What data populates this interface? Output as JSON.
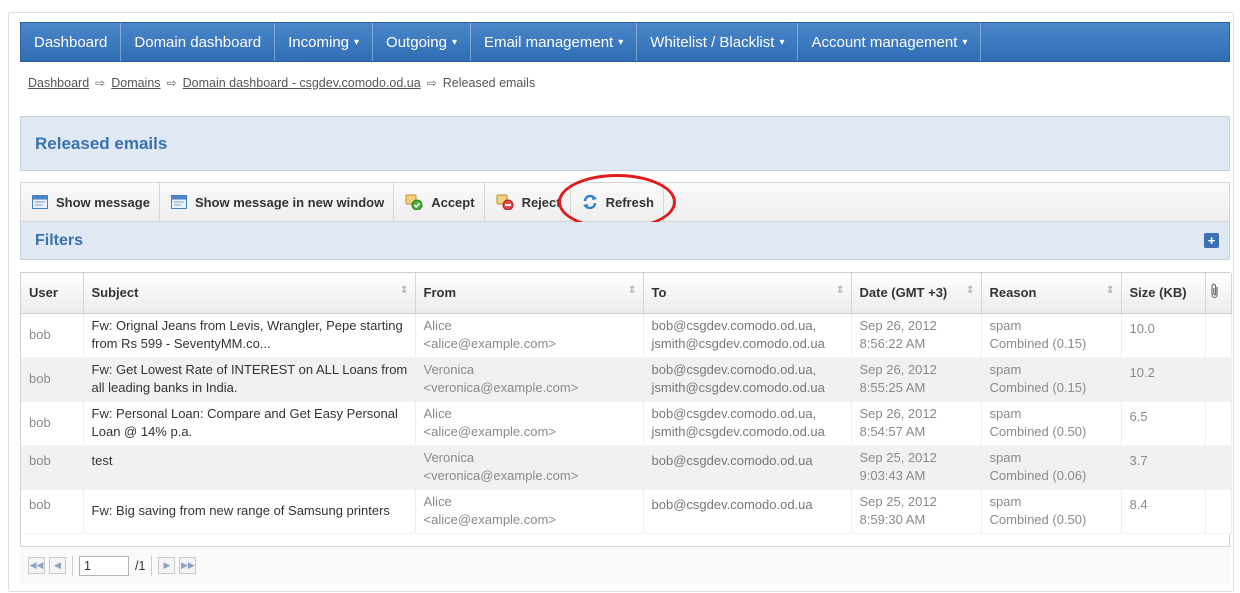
{
  "nav": {
    "items": [
      {
        "label": "Dashboard",
        "caret": false
      },
      {
        "label": "Domain dashboard",
        "caret": false
      },
      {
        "label": "Incoming",
        "caret": true
      },
      {
        "label": "Outgoing",
        "caret": true
      },
      {
        "label": "Email management",
        "caret": true
      },
      {
        "label": "Whitelist / Blacklist",
        "caret": true
      },
      {
        "label": "Account management",
        "caret": true
      }
    ],
    "caret_glyph": "▾"
  },
  "breadcrumb": {
    "links": [
      "Dashboard",
      "Domains",
      "Domain dashboard - csgdev.comodo.od.ua"
    ],
    "current": "Released emails",
    "separator": "⇨"
  },
  "page": {
    "title": "Released emails"
  },
  "toolbar": {
    "show_message": "Show message",
    "show_message_new_window": "Show message in new window",
    "accept": "Accept",
    "reject": "Reject",
    "refresh": "Refresh"
  },
  "filters": {
    "label": "Filters",
    "expand": "+"
  },
  "table": {
    "columns": {
      "user": "User",
      "subject": "Subject",
      "from": "From",
      "to": "To",
      "date": "Date (GMT +3)",
      "reason": "Reason",
      "size": "Size (KB)"
    },
    "sort_glyph": "⇕",
    "rows": [
      {
        "user": "bob",
        "subject": "Fw: Orignal Jeans from Levis, Wrangler, Pepe starting from Rs 599 - SeventyMM.co...",
        "from_name": "Alice",
        "from_email": "<alice@example.com>",
        "to_1": "bob@csgdev.comodo.od.ua,",
        "to_2": "jsmith@csgdev.comodo.od.ua",
        "date": "Sep 26, 2012",
        "time": "8:56:22 AM",
        "reason": "spam",
        "reason_detail": "Combined (0.15)",
        "size": "10.0"
      },
      {
        "user": "bob",
        "subject": "Fw: Get Lowest Rate of INTEREST on ALL Loans from all leading banks in India.",
        "from_name": "Veronica",
        "from_email": "<veronica@example.com>",
        "to_1": "bob@csgdev.comodo.od.ua,",
        "to_2": "jsmith@csgdev.comodo.od.ua",
        "date": "Sep 26, 2012",
        "time": "8:55:25 AM",
        "reason": "spam",
        "reason_detail": "Combined (0.15)",
        "size": "10.2"
      },
      {
        "user": "bob",
        "subject": "Fw: Personal Loan: Compare and Get Easy Personal Loan @ 14% p.a.",
        "from_name": "Alice",
        "from_email": "<alice@example.com>",
        "to_1": "bob@csgdev.comodo.od.ua,",
        "to_2": "jsmith@csgdev.comodo.od.ua",
        "date": "Sep 26, 2012",
        "time": "8:54:57 AM",
        "reason": "spam",
        "reason_detail": "Combined (0.50)",
        "size": "6.5"
      },
      {
        "user": "bob",
        "subject": "test",
        "from_name": "Veronica",
        "from_email": "<veronica@example.com>",
        "to_1": "bob@csgdev.comodo.od.ua",
        "to_2": "",
        "date": "Sep 25, 2012",
        "time": "9:03:43 AM",
        "reason": "spam",
        "reason_detail": "Combined (0.06)",
        "size": "3.7"
      },
      {
        "user": "bob",
        "subject": "Fw: Big saving from new range of Samsung printers",
        "from_name": "Alice",
        "from_email": "<alice@example.com>",
        "to_1": "bob@csgdev.comodo.od.ua",
        "to_2": "",
        "date": "Sep 25, 2012",
        "time": "8:59:30 AM",
        "reason": "spam",
        "reason_detail": "Combined (0.50)",
        "size": "8.4"
      }
    ]
  },
  "pager": {
    "current_page": "1",
    "total": "/1"
  },
  "colors": {
    "nav_bg": "#3a78c0",
    "accent": "#3a72b0",
    "highlight": "#e01b1b"
  }
}
